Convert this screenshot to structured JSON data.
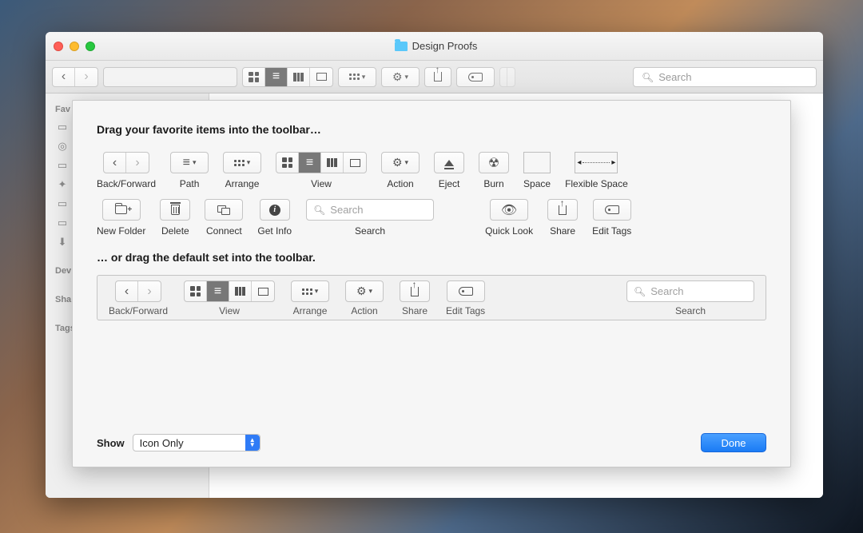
{
  "window": {
    "title": "Design Proofs"
  },
  "toolbar": {
    "search_placeholder": "Search"
  },
  "sidebar": {
    "headers": {
      "favorites": "Fav",
      "devices": "Dev",
      "shared": "Sha",
      "tags": "Tags"
    }
  },
  "sheet": {
    "heading1": "Drag your favorite items into the toolbar…",
    "heading2": "… or drag the default set into the toolbar.",
    "items": {
      "back_forward": "Back/Forward",
      "path": "Path",
      "arrange": "Arrange",
      "view": "View",
      "action": "Action",
      "eject": "Eject",
      "burn": "Burn",
      "space": "Space",
      "flexible_space": "Flexible Space",
      "new_folder": "New Folder",
      "delete": "Delete",
      "connect": "Connect",
      "get_info": "Get Info",
      "search": "Search",
      "quick_look": "Quick Look",
      "share": "Share",
      "edit_tags": "Edit Tags"
    },
    "search_placeholder": "Search",
    "defaults": {
      "back_forward": "Back/Forward",
      "view": "View",
      "arrange": "Arrange",
      "action": "Action",
      "share": "Share",
      "edit_tags": "Edit Tags",
      "search": "Search"
    },
    "footer": {
      "show_label": "Show",
      "popup_value": "Icon Only",
      "done": "Done"
    }
  }
}
